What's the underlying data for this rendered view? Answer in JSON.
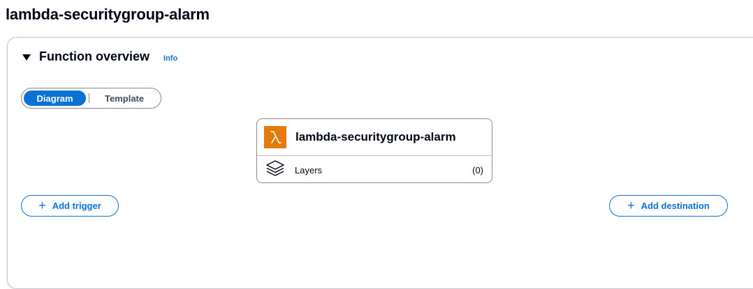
{
  "page": {
    "title": "lambda-securitygroup-alarm"
  },
  "function_overview": {
    "title": "Function overview",
    "info_link": "Info",
    "view_toggle": {
      "options": [
        "Diagram",
        "Template"
      ],
      "selected": "Diagram"
    },
    "function_card": {
      "name": "lambda-securitygroup-alarm",
      "icon": "lambda-icon",
      "layers_label": "Layers",
      "layers_count": "(0)"
    },
    "add_trigger_label": "Add trigger",
    "add_destination_label": "Add destination"
  },
  "colors": {
    "accent": "#0972d3",
    "lambda_orange": "#e07b0c",
    "text": "#000716",
    "border": "#c6c6cd"
  }
}
